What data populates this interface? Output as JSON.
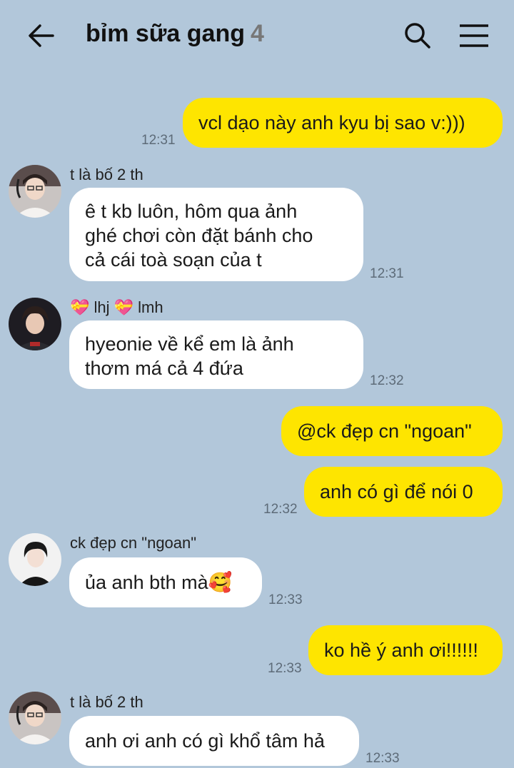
{
  "header": {
    "title": "bỉm sữa gang",
    "member_count": "4"
  },
  "messages": [
    {
      "text": "vcl dạo này anh kyu bị sao v:)))",
      "time": "12:31"
    },
    {
      "sender": "t là bố 2 th",
      "text": "ê t kb luôn, hôm qua ảnh\nghé chơi còn đặt bánh cho\ncả cái toà soạn của t",
      "time": "12:31"
    },
    {
      "sender": "💝 lhj 💝 lmh",
      "text": "hyeonie về kể em là ảnh\nthơm má cả 4 đứa",
      "time": "12:32"
    },
    {
      "text": "@ck đẹp cn \"ngoan\""
    },
    {
      "text": "anh có gì để nói 0",
      "time": "12:32"
    },
    {
      "sender": "ck đẹp cn \"ngoan\"",
      "text": "ủa anh bth mà🥰",
      "time": "12:33"
    },
    {
      "text": "ko hề ý anh ơi!!!!!!",
      "time": "12:33"
    },
    {
      "sender": "t là bố 2 th",
      "text": "anh ơi anh có gì khổ tâm hả",
      "time": "12:33"
    }
  ],
  "colors": {
    "background": "#b2c7da",
    "my_bubble": "#fee500",
    "other_bubble": "#ffffff"
  },
  "icons": {
    "back": "back-arrow-icon",
    "search": "search-icon",
    "menu": "hamburger-menu-icon"
  }
}
